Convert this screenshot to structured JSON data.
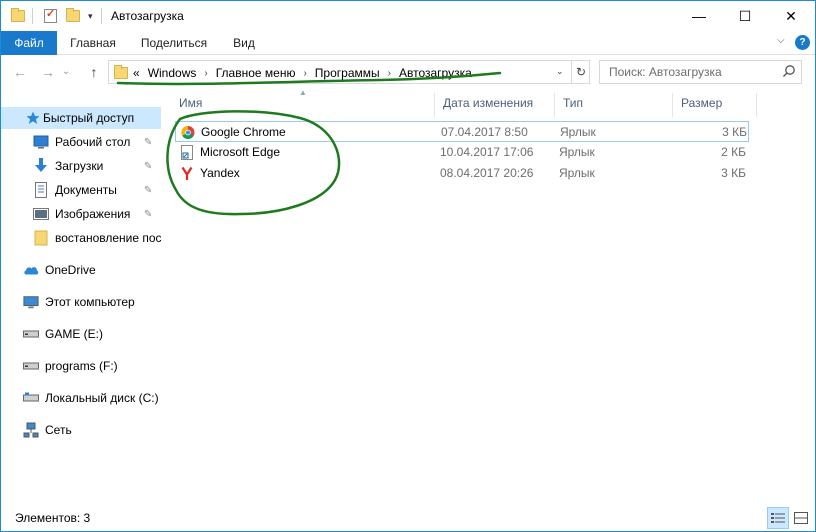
{
  "window": {
    "title": "Автозагрузка",
    "minimize_glyph": "—",
    "maximize_glyph": "☐",
    "close_glyph": "✕"
  },
  "ribbon": {
    "tabs": [
      {
        "label": "Файл",
        "active": true
      },
      {
        "label": "Главная"
      },
      {
        "label": "Поделиться"
      },
      {
        "label": "Вид"
      }
    ],
    "expand_glyph": "⌵",
    "help_glyph": "?"
  },
  "navigation": {
    "back_glyph": "←",
    "forward_glyph": "→",
    "recent_glyph": "⌄",
    "up_glyph": "↑"
  },
  "address": {
    "overflow": "«",
    "crumbs": [
      "Windows",
      "Главное меню",
      "Программы",
      "Автозагрузка"
    ],
    "separator": "›",
    "dropdown_glyph": "⌄",
    "refresh_glyph": "↻"
  },
  "search": {
    "placeholder": "Поиск: Автозагрузка"
  },
  "sidebar": {
    "items": [
      {
        "label": "Быстрый доступ",
        "icon": "star-icon",
        "selected": true
      },
      {
        "label": "Рабочий стол",
        "icon": "desktop-icon",
        "pinned": true
      },
      {
        "label": "Загрузки",
        "icon": "download-icon",
        "pinned": true
      },
      {
        "label": "Документы",
        "icon": "documents-icon",
        "pinned": true
      },
      {
        "label": "Изображения",
        "icon": "pictures-icon",
        "pinned": true
      },
      {
        "label": "востановление пос",
        "icon": "folder-icon"
      },
      {
        "label": "OneDrive",
        "icon": "cloud-icon"
      },
      {
        "label": "Этот компьютер",
        "icon": "computer-icon"
      },
      {
        "label": "GAME (E:)",
        "icon": "drive-icon"
      },
      {
        "label": "programs (F:)",
        "icon": "drive-icon"
      },
      {
        "label": "Локальный диск (C:)",
        "icon": "drive-icon"
      },
      {
        "label": "Сеть",
        "icon": "network-icon"
      }
    ],
    "pin_glyph": "📌"
  },
  "columns": {
    "name": "Имя",
    "date": "Дата изменения",
    "type": "Тип",
    "size": "Размер"
  },
  "files": [
    {
      "name": "Google Chrome",
      "date": "07.04.2017 8:50",
      "type": "Ярлык",
      "size": "3 КБ",
      "icon": "chrome-icon"
    },
    {
      "name": "Microsoft Edge",
      "date": "10.04.2017 17:06",
      "type": "Ярлык",
      "size": "2 КБ",
      "icon": "edge-shortcut-icon"
    },
    {
      "name": "Yandex",
      "date": "08.04.2017 20:26",
      "type": "Ярлык",
      "size": "3 КБ",
      "icon": "yandex-icon"
    }
  ],
  "status": {
    "items_count": "Элементов: 3"
  },
  "colors": {
    "accent": "#1979ca",
    "selection": "#cce8ff",
    "annotation": "#1f7a1f"
  }
}
